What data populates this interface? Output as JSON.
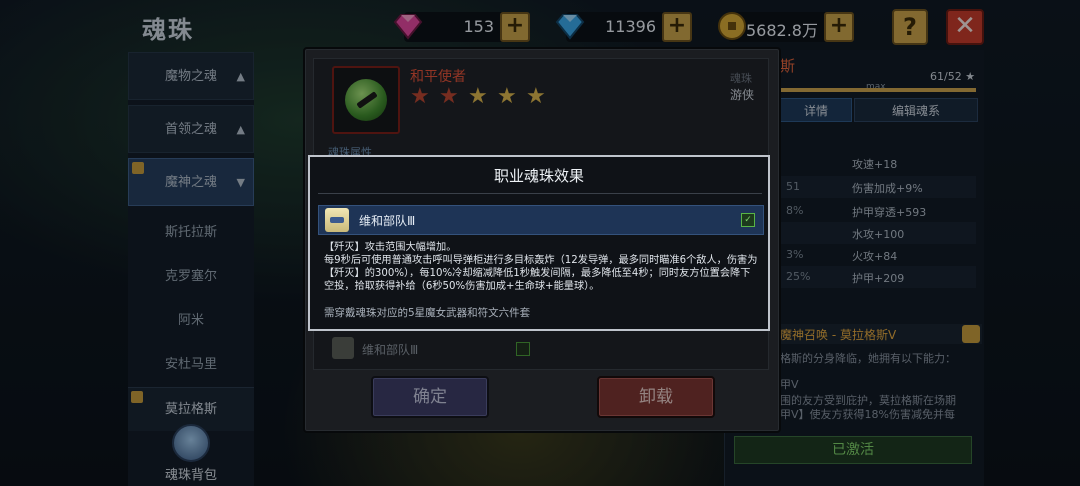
{
  "header": {
    "title": "魂珠",
    "currencies": [
      {
        "icon": "pink-gem-icon",
        "value": "153",
        "color": "#e0489e"
      },
      {
        "icon": "blue-diamond-icon",
        "value": "11396",
        "color": "#3aa6e8"
      },
      {
        "icon": "gold-coin-icon",
        "value": "5682.8万",
        "color": "#d4a836"
      }
    ],
    "plus": "+",
    "help": "?",
    "close": "✕"
  },
  "sidebar": {
    "groups": [
      {
        "label": "魔物之魂",
        "arrow": "▲"
      },
      {
        "label": "首领之魂",
        "arrow": "▲"
      },
      {
        "label": "魔神之魂",
        "arrow": "▼"
      }
    ],
    "subitems": [
      "斯托拉斯",
      "克罗塞尔",
      "阿米",
      "安杜马里",
      "莫拉格斯"
    ],
    "bag_label": "魂珠背包"
  },
  "right_panel": {
    "title": "斯",
    "progress_label": "max",
    "progress": 1.0,
    "count": "61/52 ★",
    "tabs": [
      "详情",
      "编辑魂系"
    ],
    "stats": [
      {
        "l": "",
        "r": "攻速+18"
      },
      {
        "l": "51",
        "r": "伤害加成+9%"
      },
      {
        "l": "8%",
        "r": "护甲穿透+593"
      },
      {
        "l": "",
        "r": "水攻+100"
      },
      {
        "l": "3%",
        "r": "火攻+84"
      },
      {
        "l": "25%",
        "r": "护甲+209"
      }
    ],
    "section_title": "魔神召唤 - 莫拉格斯Ⅴ",
    "section_text_1": "格斯的分身降临，她拥有以下能力：",
    "section_text_2": "甲Ⅴ",
    "section_text_3": "围的友方受到庇护，莫拉格斯在场期",
    "section_text_4": "甲Ⅴ】使友方获得18%伤害减免并每",
    "activated": "已激活"
  },
  "soul_modal": {
    "name": "和平使者",
    "stars_red": 2,
    "stars_gold": 3,
    "type_label": "魂珠",
    "class_label": "游侠",
    "attr_label": "魂珠属性",
    "under_row_text": "维和部队Ⅲ",
    "confirm": "确定",
    "unload": "卸载"
  },
  "popup": {
    "title": "职业魂珠效果",
    "effect_name": "维和部队Ⅲ",
    "description": "【歼灭】攻击范围大幅增加。\n每9秒后可使用普通攻击呼叫导弹柜进行多目标轰炸（12发导弹，最多同时瞄准6个敌人，伤害为【歼灭】的300%），每10%冷却缩减降低1秒触发间隔，最多降低至4秒；同时友方位置会降下空投，拾取获得补给（6秒50%伤害加成+生命球+能量球）。",
    "requirement": "需穿戴魂珠对应的5星魔女武器和符文六件套"
  }
}
